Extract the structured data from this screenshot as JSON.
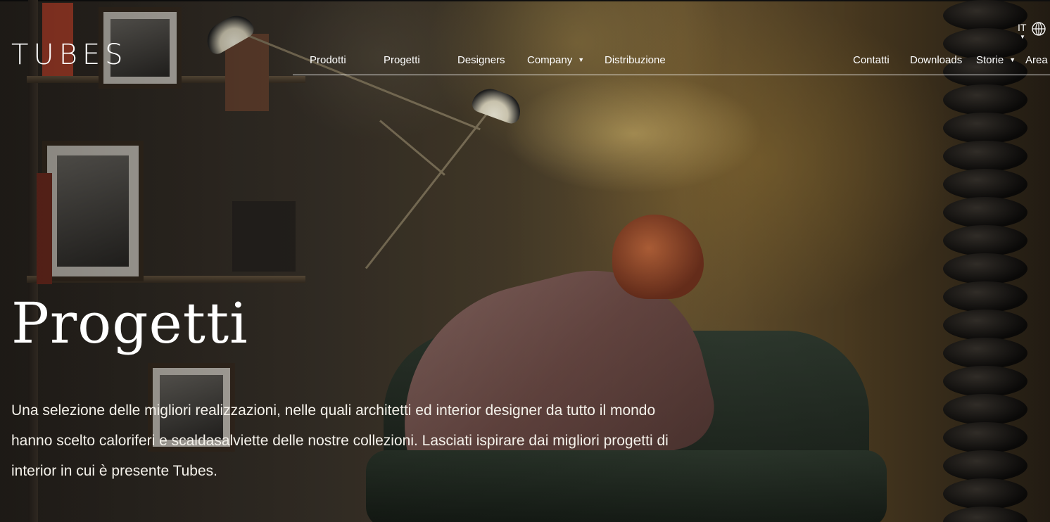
{
  "brand": {
    "logo_text": "TUBES"
  },
  "nav": {
    "left_items": [
      {
        "label": "Prodotti"
      },
      {
        "label": "Progetti"
      },
      {
        "label": "Designers"
      },
      {
        "label": "Company",
        "dropdown": true
      },
      {
        "label": "Distribuzione"
      }
    ],
    "right_items": [
      {
        "label": "Contatti"
      },
      {
        "label": "Downloads"
      },
      {
        "label": "Storie",
        "dropdown": true
      },
      {
        "label": "Area"
      }
    ],
    "language": {
      "current": "IT",
      "icon": "globe-icon"
    }
  },
  "hero": {
    "title": "Progetti",
    "description": "Una selezione delle migliori realizzazioni, nelle quali architetti ed interior designer da tutto il mondo hanno scelto caloriferi e scaldasalviette delle nostre collezioni. Lasciati ispirare dai migliori progetti di interior in cui è presente Tubes."
  },
  "colors": {
    "text": "#ffffff",
    "nav_line": "#ffffff"
  }
}
